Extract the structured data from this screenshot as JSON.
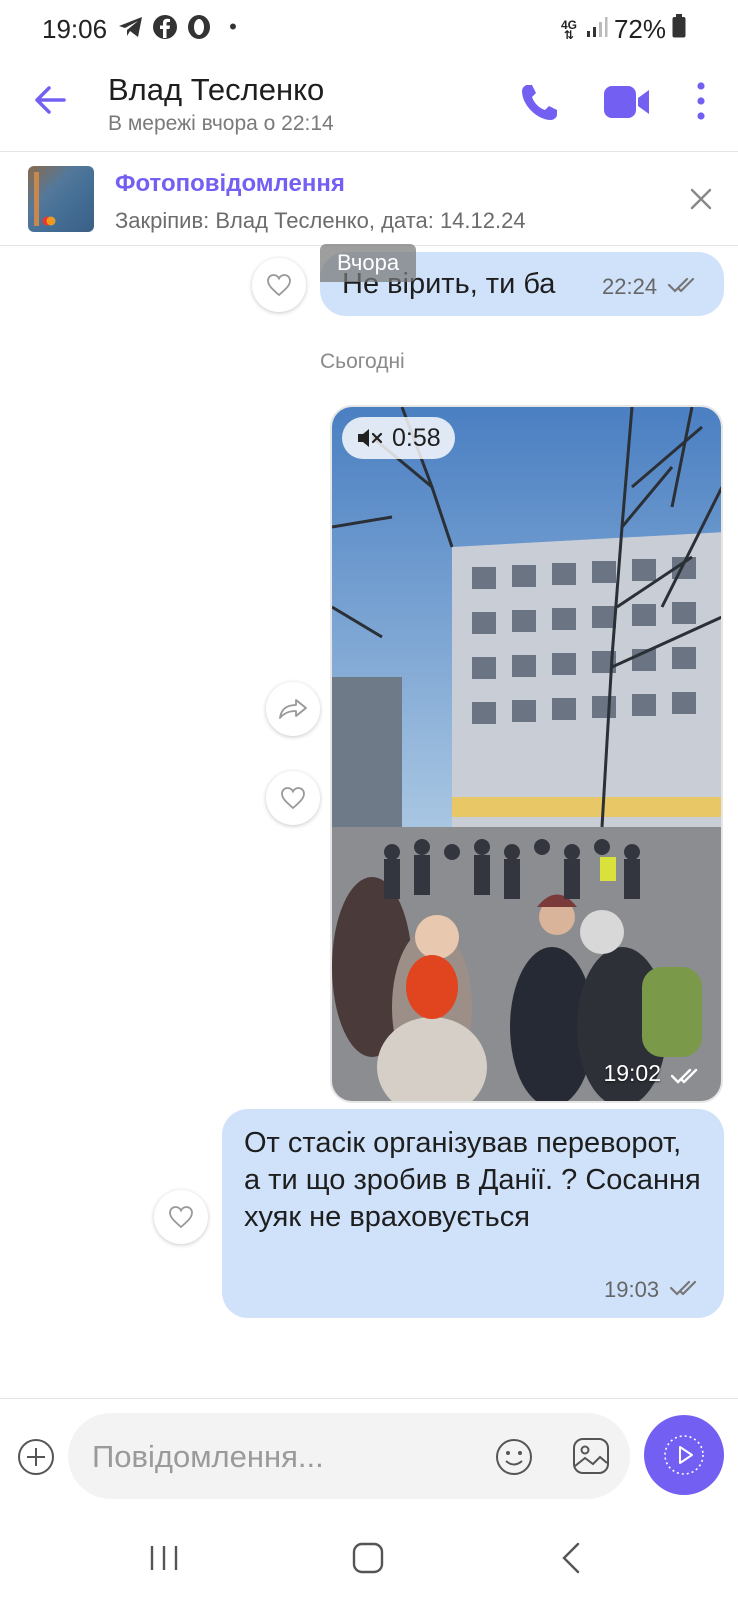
{
  "status_bar": {
    "time": "19:06",
    "dot": "•",
    "network": "4G",
    "battery": "72%",
    "icons": [
      "telegram-icon",
      "facebook-icon",
      "opera-icon",
      "signal-icon",
      "battery-icon"
    ]
  },
  "header": {
    "contact_name": "Влад Тесленко",
    "contact_status": "В мережі вчора о 22:14",
    "icons": [
      "back-arrow-icon",
      "phone-icon",
      "video-camera-icon",
      "more-vertical-icon"
    ]
  },
  "pinned": {
    "title": "Фотоповідомлення",
    "subtitle": "Закріпив: Влад Тесленко, дата: 14.12.24",
    "icons": [
      "close-icon"
    ]
  },
  "colors": {
    "accent": "#7360f2",
    "bubble": "#cfe2fa",
    "background": "#ffffff"
  },
  "messages": [
    {
      "type": "text",
      "date_label": "Вчора",
      "text": "Не вірить, ти ба",
      "time": "22:24",
      "status": "read"
    },
    {
      "type": "video",
      "duration": "0:58",
      "muted": true,
      "time": "19:02",
      "status": "read"
    },
    {
      "type": "text",
      "text": "От стасік організував переворот, а ти що зробив в Данії. ? Сосання хуяк не враховується",
      "time": "19:03",
      "status": "read"
    }
  ],
  "day_separator": "Сьогодні",
  "composer": {
    "placeholder": "Повідомлення...",
    "icons": [
      "plus-circle-icon",
      "emoji-icon",
      "gallery-icon",
      "send-icon"
    ]
  },
  "nav_bar": {
    "icons": [
      "recent-apps-icon",
      "home-icon",
      "back-icon"
    ]
  }
}
